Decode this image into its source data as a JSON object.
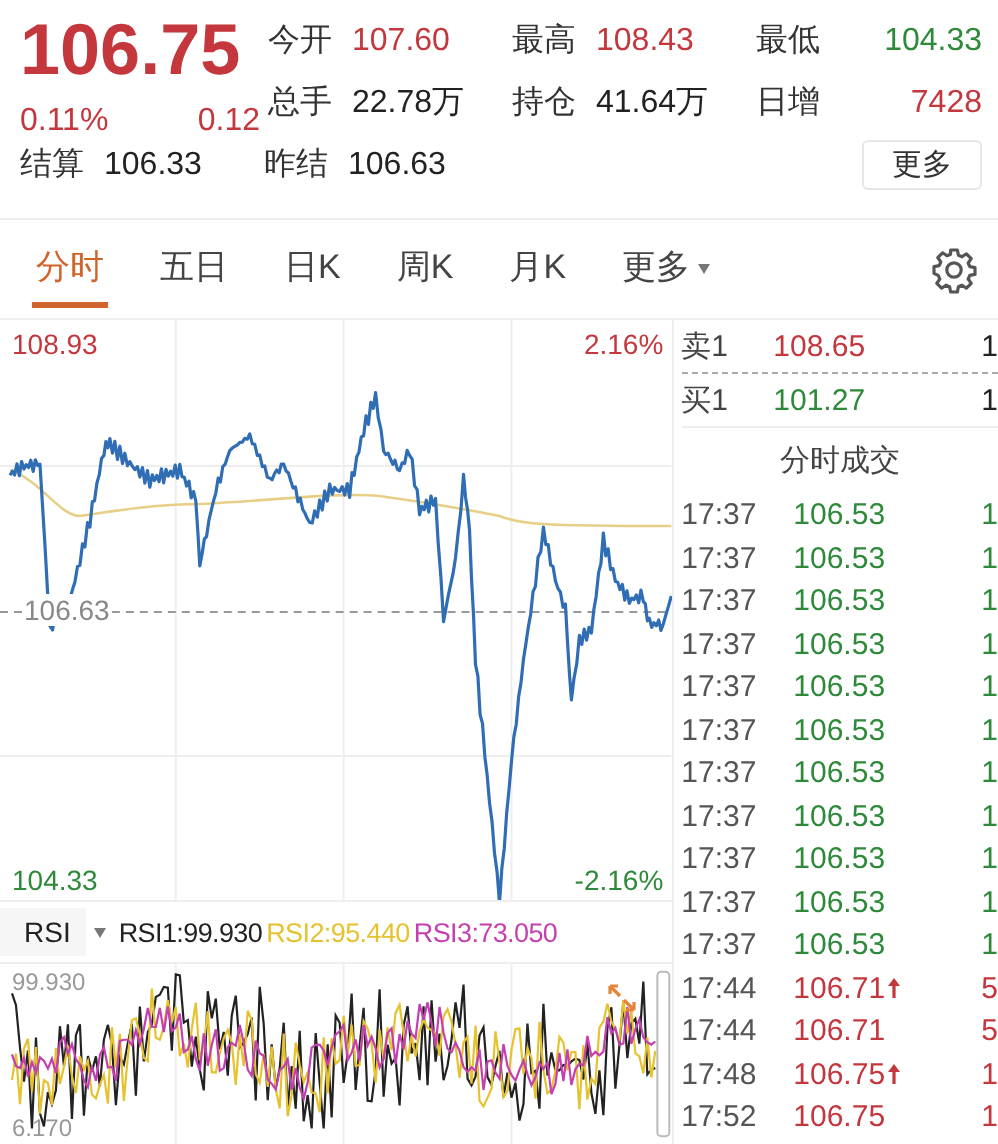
{
  "quote": {
    "price": "106.75",
    "change_pct": "0.11%",
    "change": "0.12",
    "color": "#c4373d",
    "stats": [
      {
        "label": "今开",
        "value": "107.60",
        "color": "#c4373d"
      },
      {
        "label": "最高",
        "value": "108.43",
        "color": "#c4373d"
      },
      {
        "label": "最低",
        "value": "104.33",
        "color": "#2e8a3a"
      },
      {
        "label": "总手",
        "value": "22.78万",
        "color": "#222222"
      },
      {
        "label": "持仓",
        "value": "41.64万",
        "color": "#222222"
      },
      {
        "label": "日增",
        "value": "7428",
        "color": "#c4373d"
      },
      {
        "label": "结算",
        "value": "106.33",
        "color": "#222222"
      },
      {
        "label": "昨结",
        "value": "106.63",
        "color": "#222222"
      }
    ],
    "more_button": "更多"
  },
  "tabs": [
    {
      "label": "分时",
      "selected": true,
      "dropdown": false
    },
    {
      "label": "五日",
      "selected": false,
      "dropdown": false
    },
    {
      "label": "日K",
      "selected": false,
      "dropdown": false
    },
    {
      "label": "周K",
      "selected": false,
      "dropdown": false
    },
    {
      "label": "月K",
      "selected": false,
      "dropdown": false
    },
    {
      "label": "更多",
      "selected": false,
      "dropdown": true
    }
  ],
  "chart": {
    "high": "108.93",
    "high_pct": "2.16%",
    "prev_close": "106.63",
    "low": "104.33",
    "low_pct": "-2.16%"
  },
  "order_book": [
    {
      "label": "卖1",
      "price": "108.65",
      "volume": "1",
      "color": "#c4373d"
    },
    {
      "label": "买1",
      "price": "101.27",
      "volume": "1",
      "color": "#2e8a3a"
    }
  ],
  "trades_title": "分时成交",
  "trades": [
    {
      "time": "17:37",
      "price": "106.53",
      "volume": "1",
      "color": "#2e8a3a",
      "uptick": false
    },
    {
      "time": "17:37",
      "price": "106.53",
      "volume": "1",
      "color": "#2e8a3a",
      "uptick": false
    },
    {
      "time": "17:37",
      "price": "106.53",
      "volume": "1",
      "color": "#2e8a3a",
      "uptick": false
    },
    {
      "time": "17:37",
      "price": "106.53",
      "volume": "1",
      "color": "#2e8a3a",
      "uptick": false
    },
    {
      "time": "17:37",
      "price": "106.53",
      "volume": "1",
      "color": "#2e8a3a",
      "uptick": false
    },
    {
      "time": "17:37",
      "price": "106.53",
      "volume": "1",
      "color": "#2e8a3a",
      "uptick": false
    },
    {
      "time": "17:37",
      "price": "106.53",
      "volume": "1",
      "color": "#2e8a3a",
      "uptick": false
    },
    {
      "time": "17:37",
      "price": "106.53",
      "volume": "1",
      "color": "#2e8a3a",
      "uptick": false
    },
    {
      "time": "17:37",
      "price": "106.53",
      "volume": "1",
      "color": "#2e8a3a",
      "uptick": false
    },
    {
      "time": "17:37",
      "price": "106.53",
      "volume": "1",
      "color": "#2e8a3a",
      "uptick": false
    },
    {
      "time": "17:37",
      "price": "106.53",
      "volume": "1",
      "color": "#2e8a3a",
      "uptick": false
    },
    {
      "time": "17:44",
      "price": "106.71",
      "volume": "5",
      "color": "#c4373d",
      "uptick": true
    },
    {
      "time": "17:44",
      "price": "106.71",
      "volume": "5",
      "color": "#c4373d",
      "uptick": false
    },
    {
      "time": "17:48",
      "price": "106.75",
      "volume": "1",
      "color": "#c4373d",
      "uptick": true
    },
    {
      "time": "17:52",
      "price": "106.75",
      "volume": "1",
      "color": "#c4373d",
      "uptick": false
    }
  ],
  "indicator": {
    "name": "RSI",
    "lines": [
      {
        "label": "RSI1:99.930",
        "color": "#222222"
      },
      {
        "label": "RSI2:95.440",
        "color": "#e6c22e"
      },
      {
        "label": "RSI3:73.050",
        "color": "#c43fb0"
      }
    ],
    "max": "99.930",
    "min": "6.170"
  }
}
